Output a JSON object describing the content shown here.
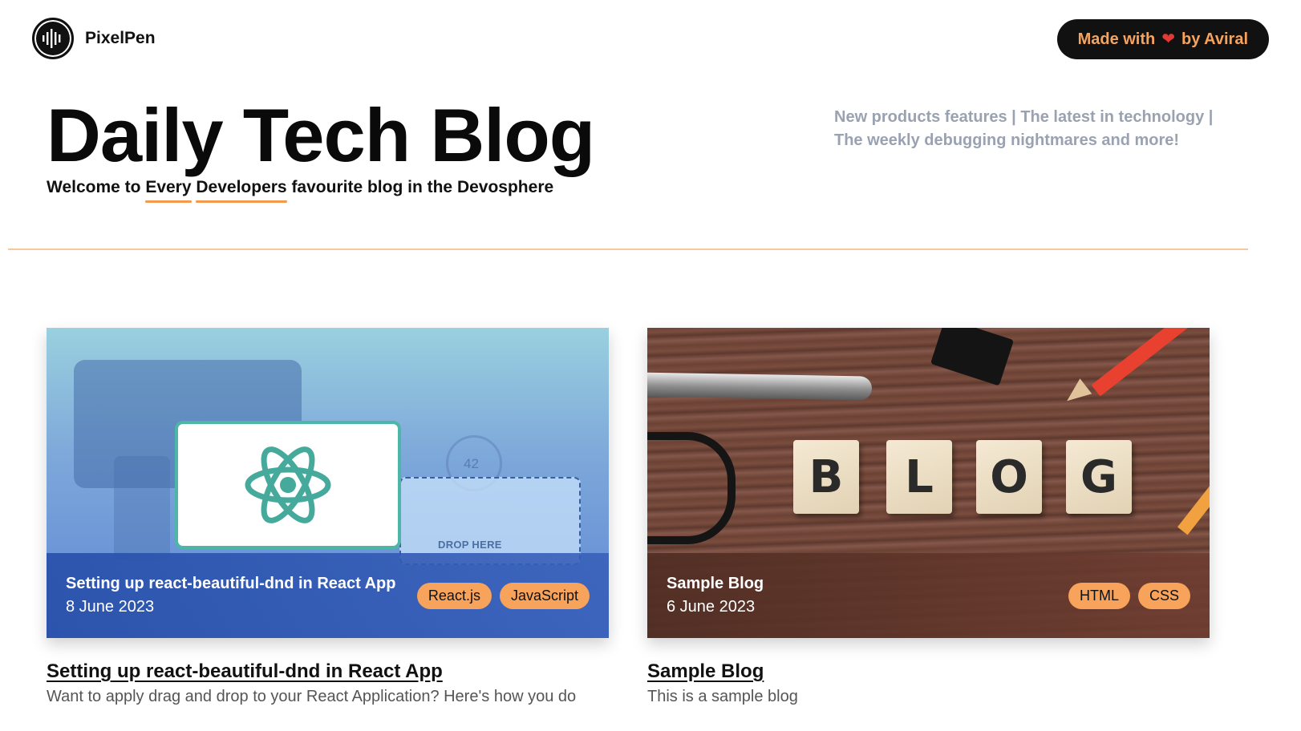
{
  "header": {
    "brand_name": "PixelPen",
    "made_with_prefix": "Made with",
    "made_with_suffix": "by Aviral",
    "accent_color": "#f7a35c"
  },
  "hero": {
    "title": "Daily Tech Blog",
    "subtitle_parts": [
      "Welcome to ",
      "Every",
      " ",
      "Developers",
      " favourite blog in the Devosphere"
    ],
    "tagline": "New products features | The latest in technology | The weekly debugging nightmares and more!"
  },
  "posts": [
    {
      "overlay_title": "Setting up react-beautiful-dnd in React App",
      "date": "8 June 2023",
      "tags": [
        "React.js",
        "JavaScript"
      ],
      "title": "Setting up react-beautiful-dnd in React App",
      "description": "Want to apply drag and drop to your React Application? Here's how you do",
      "image_labels": {
        "drop": "DROP HERE",
        "gauge": "42"
      }
    },
    {
      "overlay_title": "Sample Blog",
      "date": "6 June 2023",
      "tags": [
        "HTML",
        "CSS"
      ],
      "title": "Sample Blog",
      "description": "This is a sample blog",
      "image_letters": [
        "B",
        "L",
        "O",
        "G"
      ]
    }
  ]
}
